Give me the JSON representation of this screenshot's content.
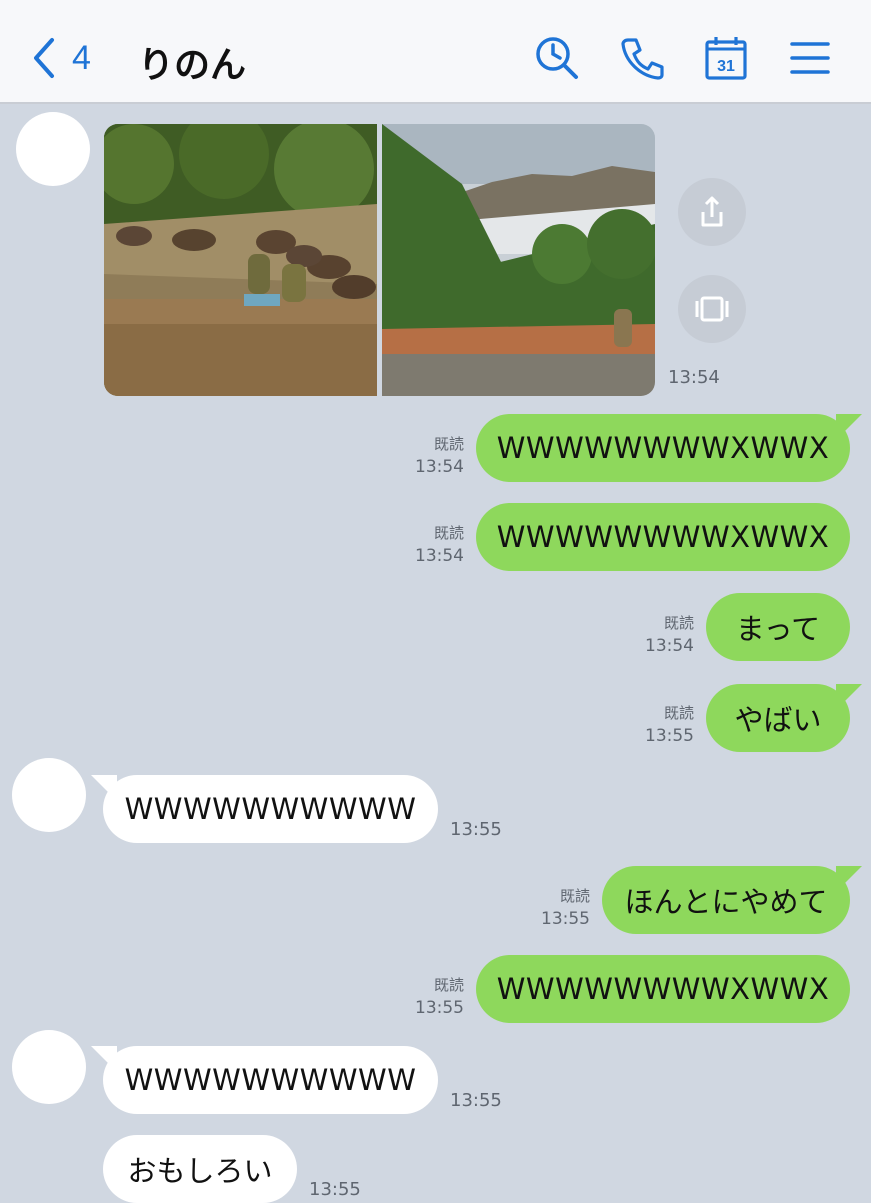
{
  "header": {
    "back_count": "4",
    "title": "りのん",
    "icons": [
      "back-chevron-icon",
      "search-clock-icon",
      "phone-icon",
      "calendar-icon",
      "menu-icon"
    ],
    "calendar_day": "31",
    "accent_color": "#1f74d6"
  },
  "colors": {
    "background": "#d0d7e1",
    "sent_bubble": "#8ed85c",
    "received_bubble": "#ffffff"
  },
  "messages": [
    {
      "type": "image",
      "time": "13:54"
    },
    {
      "type": "sent",
      "text": "WWWWWWWWXWWX",
      "read": "既読",
      "time": "13:54"
    },
    {
      "type": "sent",
      "text": "WWWWWWWWXWWX",
      "read": "既読",
      "time": "13:54"
    },
    {
      "type": "sent",
      "text": "まって",
      "read": "既読",
      "time": "13:54"
    },
    {
      "type": "sent",
      "text": "やばい",
      "read": "既読",
      "time": "13:55"
    },
    {
      "type": "received",
      "text": "WWWWWWWWWW",
      "time": "13:55"
    },
    {
      "type": "sent",
      "text": "ほんとにやめて",
      "read": "既読",
      "time": "13:55"
    },
    {
      "type": "sent",
      "text": "WWWWWWWWXWWX",
      "read": "既読",
      "time": "13:55"
    },
    {
      "type": "received",
      "text": "WWWWWWWWWW",
      "time": "13:55"
    },
    {
      "type": "received",
      "text": "おもしろい",
      "time": "13:55"
    }
  ]
}
